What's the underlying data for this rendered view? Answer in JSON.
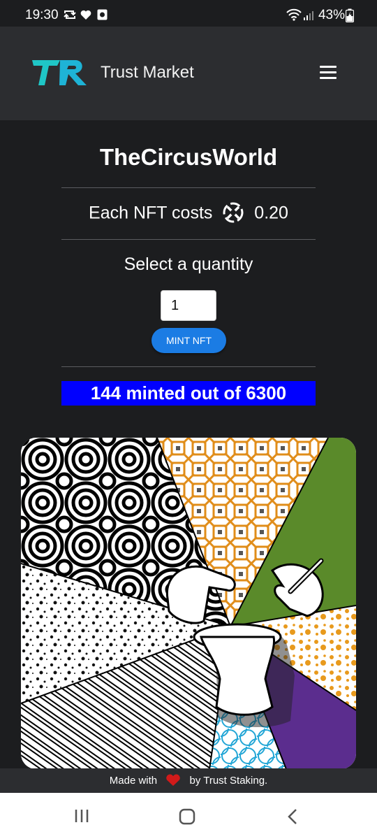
{
  "status_bar": {
    "time": "19:30",
    "battery": "43%",
    "icons": [
      "sync-icon",
      "heart-icon",
      "notification-icon",
      "wifi-icon",
      "signal-icon",
      "battery-icon"
    ]
  },
  "navbar": {
    "brand_name": "Trust Market",
    "logo_text": "TR",
    "menu_icon": "hamburger-menu-icon"
  },
  "collection": {
    "title": "TheCircusWorld",
    "cost_label": "Each NFT costs",
    "cost_value": "0.20",
    "currency_icon": "egld-icon"
  },
  "mint": {
    "quantity_label": "Select a quantity",
    "quantity_value": "1",
    "mint_button_label": "MINT NFT",
    "progress_text": "144 minted out of 6300",
    "minted": 144,
    "total": 6300
  },
  "preview_image": {
    "description_icon": "nft-artwork-image"
  },
  "footer": {
    "made_with": "Made with",
    "by_text": "by Trust Staking."
  },
  "colors": {
    "background": "#1c1d1f",
    "navbar": "#2c2d30",
    "accent_blue": "#1b7ce4",
    "progress_bg": "#0000ff",
    "logo_teal": "#1fc6c6",
    "heart_red": "#d11a1a"
  },
  "system_nav": {
    "buttons": [
      "recent-apps-icon",
      "home-icon",
      "back-icon"
    ]
  }
}
